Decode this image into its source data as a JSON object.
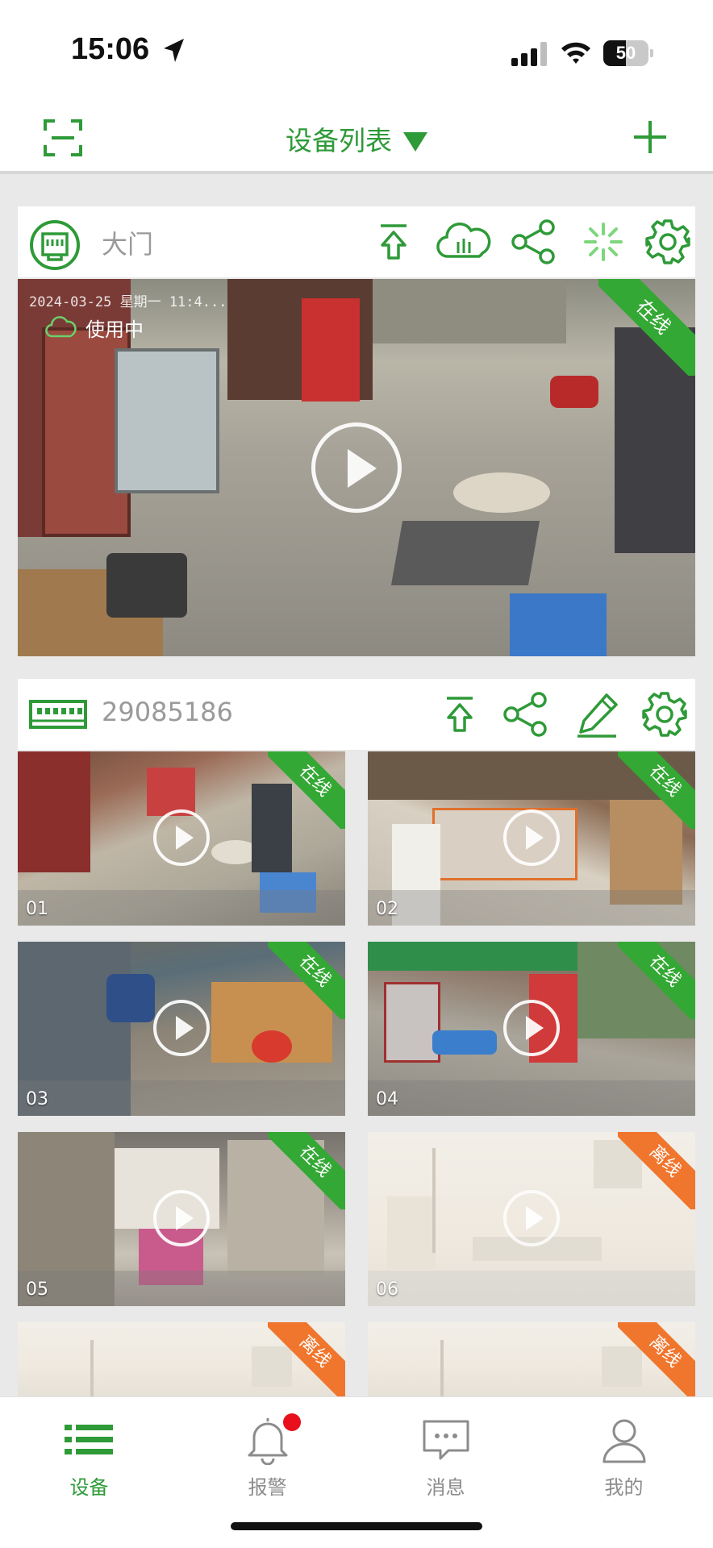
{
  "status_bar": {
    "time": "15:06",
    "battery": "50",
    "battery_level": 0.5
  },
  "nav": {
    "title": "设备列表",
    "scan_icon": "scan-icon",
    "add_icon": "plus-icon"
  },
  "device1": {
    "name": "大门",
    "icon": "network-port-icon",
    "actions": [
      "upload-icon",
      "cloud-icon",
      "share-icon",
      "loading-icon",
      "settings-icon"
    ],
    "status": "在线",
    "in_use_label": "使用中",
    "timestamp": "2024-03-25 星期一 11:4..."
  },
  "device2": {
    "name": "29085186",
    "icon": "nvr-icon",
    "actions": [
      "upload-icon",
      "share-icon",
      "edit-icon",
      "settings-icon"
    ],
    "channels": [
      {
        "label": "01",
        "status": "在线"
      },
      {
        "label": "02",
        "status": "在线"
      },
      {
        "label": "03",
        "status": "在线"
      },
      {
        "label": "04",
        "status": "在线"
      },
      {
        "label": "05",
        "status": "在线"
      },
      {
        "label": "06",
        "status": "离线"
      },
      {
        "label": "",
        "status": "离线"
      },
      {
        "label": "",
        "status": "离线"
      }
    ]
  },
  "tabs": [
    {
      "label": "设备",
      "icon": "list-icon",
      "active": true
    },
    {
      "label": "报警",
      "icon": "bell-icon",
      "active": false,
      "badge": true
    },
    {
      "label": "消息",
      "icon": "message-icon",
      "active": false
    },
    {
      "label": "我的",
      "icon": "user-icon",
      "active": false
    }
  ],
  "colors": {
    "accent": "#2e9a38",
    "online": "#34a834",
    "offline": "#f0752d",
    "badge": "#e8101c"
  }
}
